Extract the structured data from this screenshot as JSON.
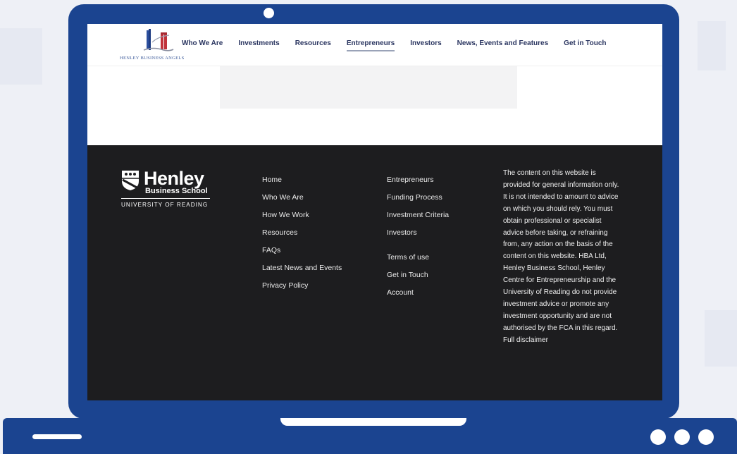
{
  "header": {
    "logo_text": "HENLEY BUSINESS ANGELS",
    "nav": [
      {
        "label": "Who We Are"
      },
      {
        "label": "Investments"
      },
      {
        "label": "Resources"
      },
      {
        "label": "Entrepreneurs",
        "active": true
      },
      {
        "label": "Investors"
      },
      {
        "label": "News, Events and Features"
      },
      {
        "label": "Get in Touch"
      }
    ]
  },
  "footer": {
    "logo": {
      "name": "Henley",
      "school": "Business School",
      "university": "UNIVERSITY OF READING"
    },
    "links_col1": [
      "Home",
      "Who We Are",
      "How We Work",
      "Resources",
      "FAQs",
      "Latest News and Events",
      "Privacy Policy"
    ],
    "links_col2": [
      "Entrepreneurs",
      "Funding Process",
      "Investment Criteria",
      "Investors"
    ],
    "links_col3": [
      "Terms of use",
      "Get in Touch",
      "Account"
    ],
    "disclaimer": "The content on this website is provided for general information only. It is not intended to amount to advice on which you should rely. You must obtain professional or specialist advice before taking, or refraining from, any action on the basis of the content on this website. HBA Ltd, Henley Business School, Henley Centre for Entrepreneurship and the University of Reading do not provide investment advice or promote any investment opportunity and are not authorised by the FCA in this regard. Full disclaimer"
  },
  "colors": {
    "laptop_frame": "#1b4490",
    "footer_bg": "#1d1d1f",
    "nav_text": "#2a3560",
    "page_bg": "#eef0f6"
  }
}
